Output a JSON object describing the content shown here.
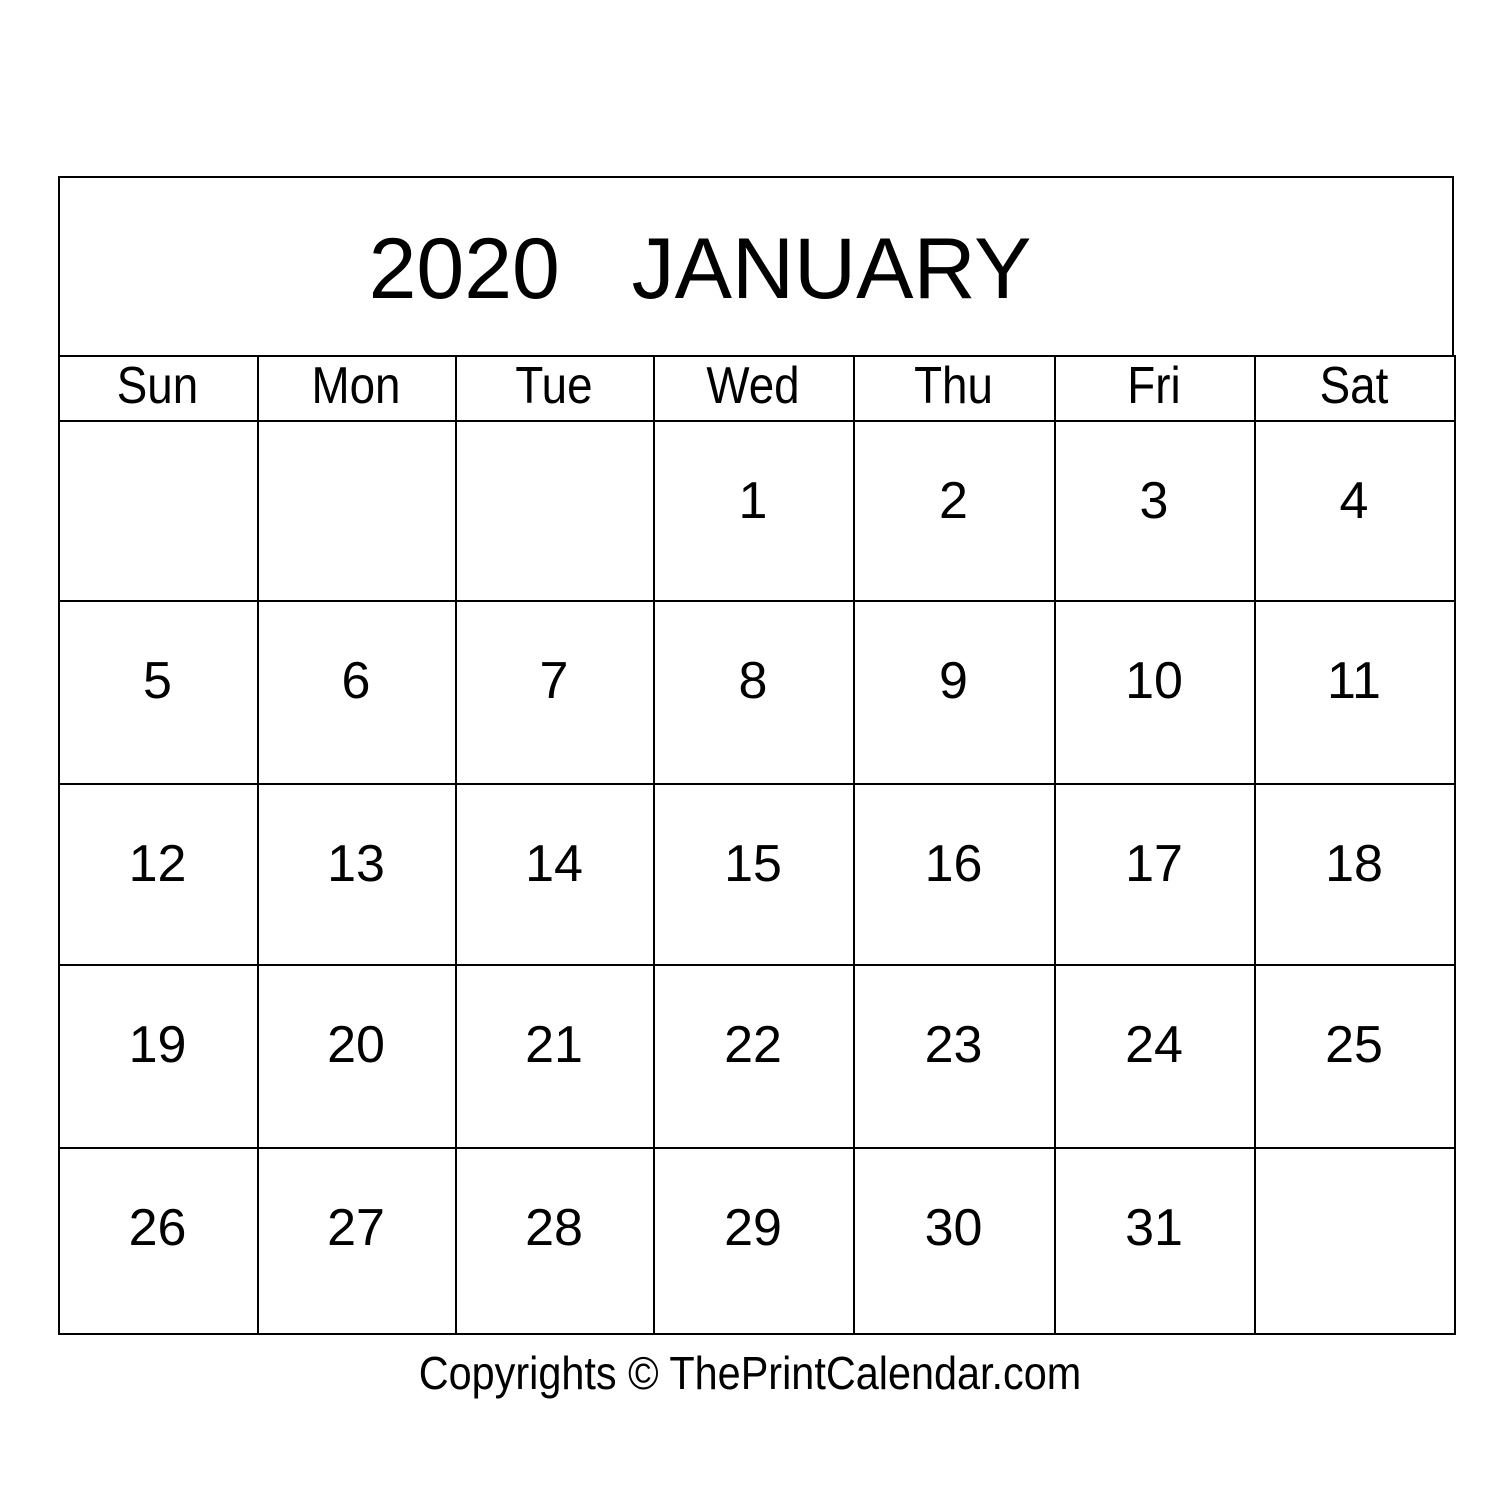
{
  "calendar": {
    "year": "2020",
    "month": "JANUARY",
    "weekdays": [
      "Sun",
      "Mon",
      "Tue",
      "Wed",
      "Thu",
      "Fri",
      "Sat"
    ],
    "weeks": [
      [
        "",
        "",
        "",
        "1",
        "2",
        "3",
        "4"
      ],
      [
        "5",
        "6",
        "7",
        "8",
        "9",
        "10",
        "11"
      ],
      [
        "12",
        "13",
        "14",
        "15",
        "16",
        "17",
        "18"
      ],
      [
        "19",
        "20",
        "21",
        "22",
        "23",
        "24",
        "25"
      ],
      [
        "26",
        "27",
        "28",
        "29",
        "30",
        "31",
        ""
      ]
    ]
  },
  "footer": {
    "copyright": "Copyrights © ThePrintCalendar.com"
  }
}
